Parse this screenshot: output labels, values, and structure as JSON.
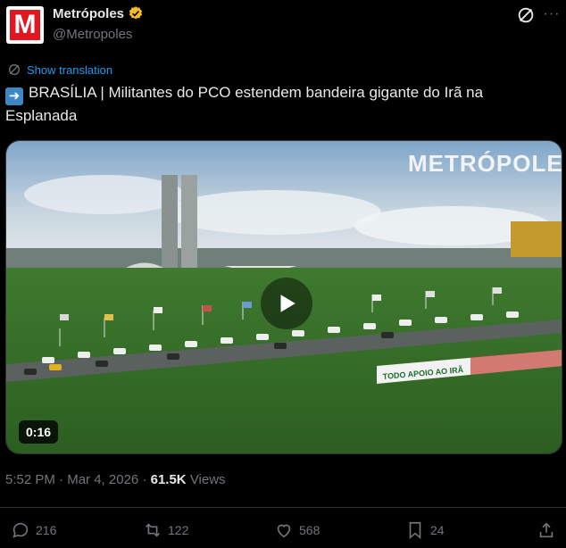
{
  "account": {
    "display_name": "Metrópoles",
    "handle": "@Metropoles",
    "avatar_letter": "M",
    "verified": true,
    "verified_color": "#f7b928",
    "brand_color": "#e0171f"
  },
  "translate": {
    "label": "Show translation"
  },
  "tweet": {
    "text": "BRASÍLIA | Militantes do PCO estendem bandeira gigante do Irã na Esplanada",
    "emoji": "➡️"
  },
  "media": {
    "type": "video",
    "duration": "0:16",
    "overlay_logo": "METRÓPOLES",
    "banner_text": "TODO APOIO AO IRÃ"
  },
  "meta": {
    "time": "5:52 PM",
    "separator": "·",
    "date": "Mar 4, 2026",
    "views_count": "61.5K",
    "views_label": "Views"
  },
  "actions": {
    "replies": "216",
    "reposts": "122",
    "likes": "568",
    "bookmarks": "24"
  },
  "colors": {
    "background": "#000000",
    "text": "#e7e9ea",
    "muted": "#71767b",
    "link": "#1d9bf0",
    "divider": "#2f3336"
  }
}
